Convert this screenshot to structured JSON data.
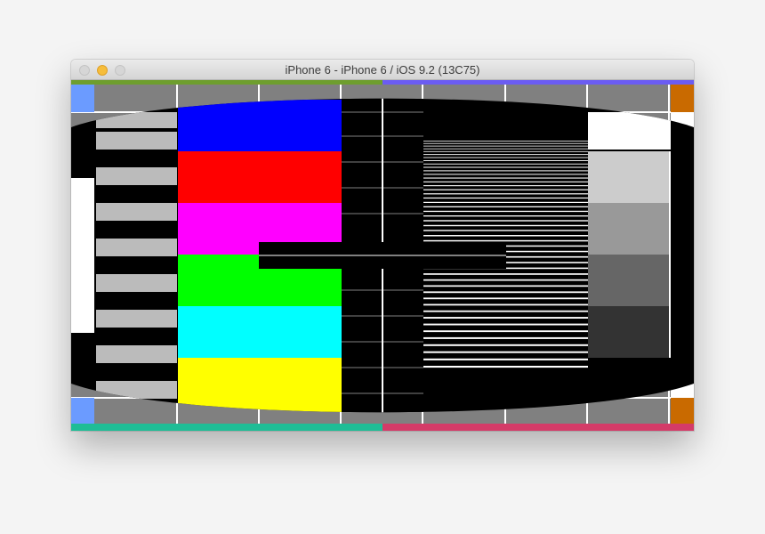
{
  "window": {
    "title": "iPhone 6 - iPhone 6 / iOS 9.2 (13C75)"
  },
  "test_pattern": {
    "border_strip_colors": {
      "top_left": "#6e9e2e",
      "top_right": "#6b5cf2",
      "bottom_left": "#1ebd96",
      "bottom_right": "#d43b68"
    },
    "corner_colors": {
      "left": "#6b9bff",
      "right": "#c96a00"
    },
    "color_bars": [
      "#0000ff",
      "#ff0000",
      "#ff00ff",
      "#00ff00",
      "#00ffff",
      "#ffff00"
    ],
    "gray_steps": [
      "#cccccc",
      "#999999",
      "#666666",
      "#333333"
    ],
    "grid_gray": "#808080"
  }
}
